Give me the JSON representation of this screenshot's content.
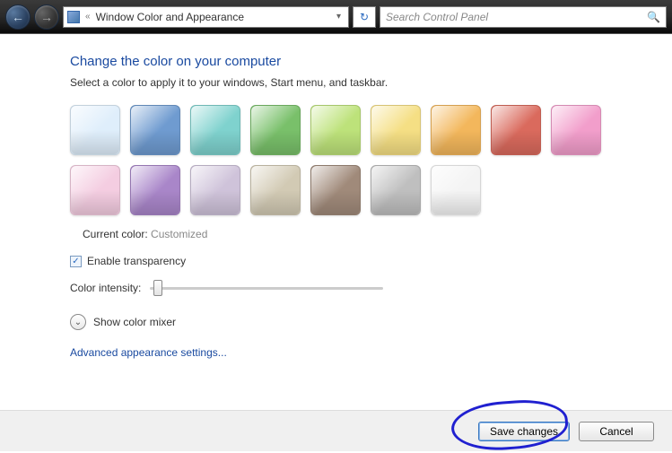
{
  "nav": {
    "breadcrumb": "Window Color and Appearance",
    "search_placeholder": "Search Control Panel"
  },
  "page": {
    "heading": "Change the color on your computer",
    "subtext": "Select a color to apply it to your windows, Start menu, and taskbar.",
    "current_label": "Current color:",
    "current_value": "Customized",
    "transparency_label": "Enable transparency",
    "transparency_checked": true,
    "intensity_label": "Color intensity:",
    "mixer_label": "Show color mixer",
    "advanced_link": "Advanced appearance settings..."
  },
  "swatches": [
    {
      "name": "sky",
      "color": "#dfeefb"
    },
    {
      "name": "blue",
      "color": "#6f9bd0"
    },
    {
      "name": "teal",
      "color": "#7fd2ce"
    },
    {
      "name": "green",
      "color": "#79c06a"
    },
    {
      "name": "lime",
      "color": "#bde27a"
    },
    {
      "name": "yellow",
      "color": "#f5df84"
    },
    {
      "name": "orange",
      "color": "#f3b75c"
    },
    {
      "name": "red",
      "color": "#da6a5d"
    },
    {
      "name": "pink",
      "color": "#f29ecb"
    },
    {
      "name": "blush",
      "color": "#f4cde1"
    },
    {
      "name": "violet",
      "color": "#a986c9"
    },
    {
      "name": "lavender",
      "color": "#cfc3da"
    },
    {
      "name": "taupe",
      "color": "#d2cab4"
    },
    {
      "name": "brown",
      "color": "#a08a7a"
    },
    {
      "name": "gray",
      "color": "#bfbfbf"
    },
    {
      "name": "white",
      "color": "#f4f4f4"
    }
  ],
  "footer": {
    "save": "Save changes",
    "cancel": "Cancel"
  }
}
